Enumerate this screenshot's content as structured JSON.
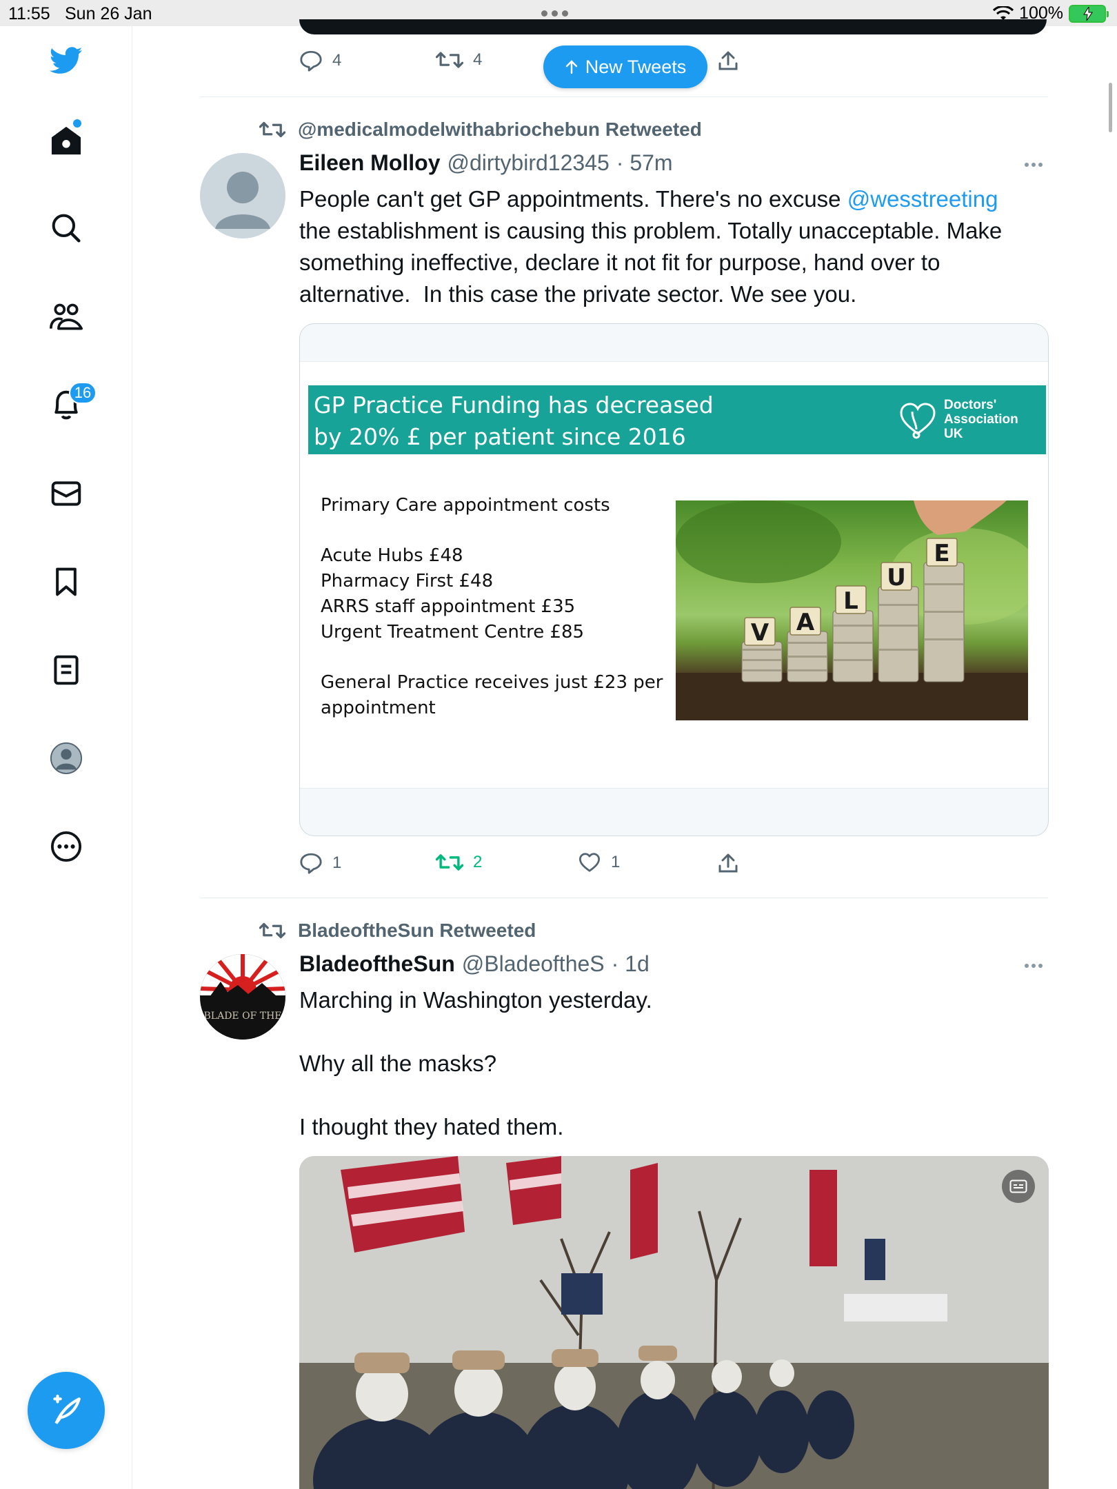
{
  "status_bar": {
    "time": "11:55",
    "date": "Sun 26 Jan",
    "battery": "100%"
  },
  "nav": {
    "notifications_badge": "16",
    "icons": [
      "twitter-logo-icon",
      "home-icon",
      "search-icon",
      "communities-icon",
      "bell-icon",
      "mail-icon",
      "bookmark-icon",
      "lists-icon",
      "profile-avatar",
      "more-icon",
      "compose-icon"
    ]
  },
  "top_tweet": {
    "reply_count": "4",
    "retweet_count": "4"
  },
  "new_tweets_label": "New Tweets",
  "tweet1": {
    "retweeted_by": "@medicalmodelwithabriochebun Retweeted",
    "name": "Eileen Molloy",
    "handle": "@dirtybird12345",
    "time": "· 57m",
    "text_before": "People can't get GP appointments. There's no excuse ",
    "mention": "@wesstreeting",
    "text_after": "\nthe establishment is causing this problem. Totally unacceptable. Make something ineffective, declare it not fit for purpose, hand over to alternative.  In this case the private sector. We see you.",
    "image": {
      "banner_title": "GP Practice Funding has decreased by 20% £ per patient since 2016",
      "org_line1": "Doctors'",
      "org_line2": "Association",
      "org_line3": "UK",
      "heading": "Primary Care appointment costs",
      "items": [
        "Acute Hubs £48",
        "Pharmacy First £48",
        "ARRS staff appointment £35",
        "Urgent Treatment Centre £85"
      ],
      "footer": "General Practice receives just £23 per appointment",
      "photo_letters": [
        "V",
        "A",
        "L",
        "U",
        "E"
      ]
    },
    "reply_count": "1",
    "retweet_count": "2",
    "like_count": "1"
  },
  "tweet2": {
    "retweeted_by": "BladeoftheSun Retweeted",
    "name": "BladeoftheSun",
    "handle": "@BladeoftheS",
    "time": "· 1d",
    "text": "Marching in Washington yesterday.\n\nWhy all the masks?\n\nI thought they hated them.",
    "avatar_text": "BLADE OF THE"
  },
  "colors": {
    "accent": "#1d9bf0",
    "retweet_green": "#00ba7c",
    "secondary_text": "#536471",
    "banner_teal": "#17a398"
  }
}
